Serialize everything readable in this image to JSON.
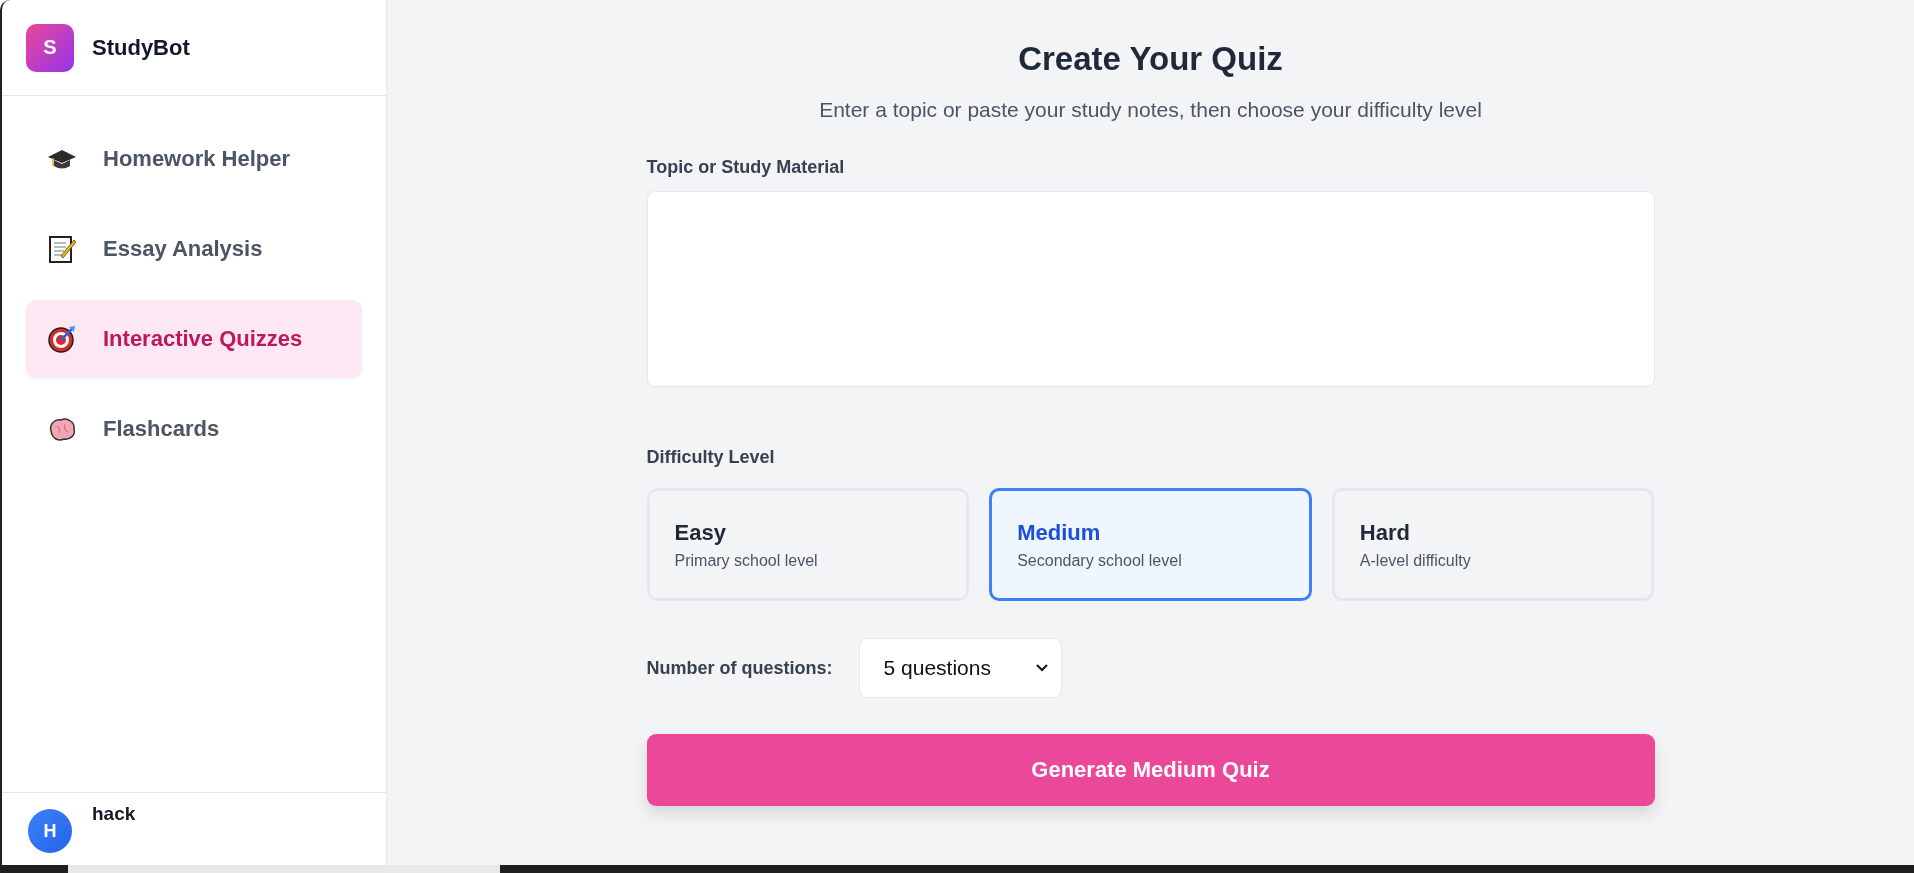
{
  "sidebar": {
    "brand": {
      "logo": "S",
      "name": "StudyBot"
    },
    "items": [
      {
        "label": "Homework Helper",
        "kind": "cap",
        "selected": false
      },
      {
        "label": "Essay Analysis",
        "kind": "memo",
        "selected": false
      },
      {
        "label": "Interactive Quizzes",
        "kind": "target",
        "selected": true
      },
      {
        "label": "Flashcards",
        "kind": "brain",
        "selected": false
      }
    ],
    "user": {
      "avatar": "H",
      "name": "hack"
    }
  },
  "main": {
    "title": "Create Your Quiz",
    "subtitle": "Enter a topic or paste your study notes, then choose your difficulty level",
    "topic": {
      "label": "Topic or Study Material"
    },
    "difficulty": {
      "label": "Difficulty Level",
      "options": [
        {
          "name": "Easy",
          "description": "Primary school level",
          "selected": false
        },
        {
          "name": "Medium",
          "description": "Secondary school level",
          "selected": true
        },
        {
          "name": "Hard",
          "description": "A-level difficulty",
          "selected": false
        }
      ]
    },
    "questions": {
      "label": "Number of questions:",
      "value": "5 questions"
    },
    "submit": "Generate Medium Quiz"
  }
}
